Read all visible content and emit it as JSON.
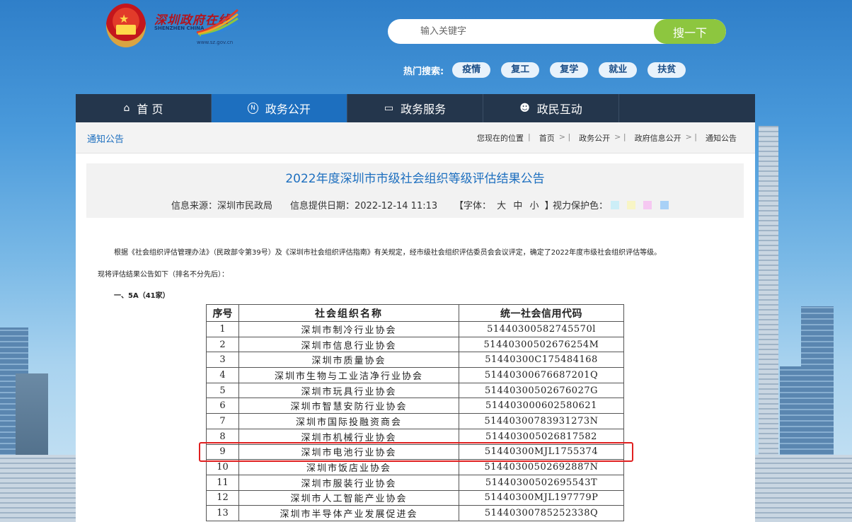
{
  "header": {
    "logo_text": "深圳政府在线",
    "logo_en": "SHENZHEN CHINA",
    "logo_url": "www.sz.gov.cn",
    "search_placeholder": "输入关键字",
    "search_button": "搜一下",
    "hot_label": "热门搜索:",
    "hot_tags": [
      "疫情",
      "复工",
      "复学",
      "就业",
      "扶贫"
    ]
  },
  "nav": {
    "items": [
      {
        "label": "首 页",
        "icon": "home-icon"
      },
      {
        "label": "政务公开",
        "icon": "news-icon"
      },
      {
        "label": "政务服务",
        "icon": "monitor-icon"
      },
      {
        "label": "政民互动",
        "icon": "people-icon"
      }
    ],
    "active_index": 1
  },
  "breadcrumb": {
    "section": "通知公告",
    "prefix": "您现在的位置",
    "items": [
      "首页",
      "政务公开",
      "政府信息公开",
      "通知公告"
    ]
  },
  "article": {
    "title": "2022年度深圳市市级社会组织等级评估结果公告",
    "source": "信息来源：深圳市民政局",
    "date": "信息提供日期：2022-12-14 11:13",
    "font_size_prefix": "【字体：",
    "font_sizes": [
      "大",
      "中",
      "小"
    ],
    "font_size_suffix": "】",
    "eye_care_label": "视力保护色：",
    "eye_care_colors": [
      "#cceef7",
      "#f8f5c5",
      "#f6c8f2",
      "#a9d1f7"
    ],
    "paragraph1": "根据《社会组织评估管理办法》（民政部令第39号）及《深圳市社会组织评估指南》有关规定，经市级社会组织评估委员会会议评定，确定了2022年度市级社会组织评估等级。",
    "paragraph2": "现将评估结果公告如下（排名不分先后）：",
    "subheading": "一、5A（41家）"
  },
  "table": {
    "headers": [
      "序号",
      "社会组织名称",
      "统一社会信用代码"
    ],
    "rows": [
      [
        "1",
        "深圳市制冷行业协会",
        "51440300582745570l"
      ],
      [
        "2",
        "深圳市信息行业协会",
        "51440300502676254M"
      ],
      [
        "3",
        "深圳市质量协会",
        "51440300C175484168"
      ],
      [
        "4",
        "深圳市生物与工业洁净行业协会",
        "51440300676687201Q"
      ],
      [
        "5",
        "深圳市玩具行业协会",
        "51440300502676027G"
      ],
      [
        "6",
        "深圳市智慧安防行业协会",
        "514403000602580621"
      ],
      [
        "7",
        "深圳市国际投融资商会",
        "51440300783931273N"
      ],
      [
        "8",
        "深圳市机械行业协会",
        "514403005026817582"
      ],
      [
        "9",
        "深圳市电池行业协会",
        "51440300MJL1755374"
      ],
      [
        "10",
        "深圳市饭店业协会",
        "51440300502692887N"
      ],
      [
        "11",
        "深圳市服装行业协会",
        "51440300502695543T"
      ],
      [
        "12",
        "深圳市人工智能产业协会",
        "51440300MJL197779P"
      ],
      [
        "13",
        "深圳市半导体产业发展促进会",
        "51440300785252338Q"
      ]
    ],
    "highlighted_row_index": 8
  }
}
